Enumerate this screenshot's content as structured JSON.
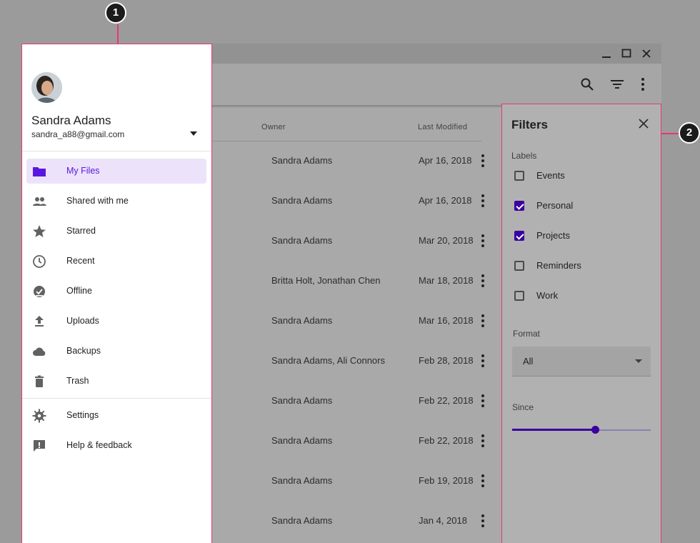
{
  "window": {
    "controls": [
      "minimize-icon",
      "maximize-icon",
      "close-icon"
    ],
    "appbar_icons": [
      "search-icon",
      "filter-list-icon",
      "more-vert-icon"
    ]
  },
  "table": {
    "headers": {
      "owner": "Owner",
      "modified": "Last Modified"
    },
    "rows": [
      {
        "owner": "Sandra Adams",
        "date": "Apr 16, 2018"
      },
      {
        "owner": "Sandra Adams",
        "date": "Apr 16, 2018"
      },
      {
        "owner": "Sandra Adams",
        "date": "Mar 20, 2018"
      },
      {
        "owner": "Britta Holt, Jonathan Chen",
        "date": "Mar 18, 2018"
      },
      {
        "owner": "Sandra Adams",
        "date": "Mar 16, 2018"
      },
      {
        "owner": "Sandra Adams, Ali Connors",
        "date": "Feb 28, 2018"
      },
      {
        "owner": "Sandra Adams",
        "date": "Feb 22, 2018"
      },
      {
        "owner": "Sandra Adams",
        "date": "Feb 22, 2018"
      },
      {
        "owner": "Sandra Adams",
        "date": "Feb 19, 2018"
      },
      {
        "owner": "Sandra Adams",
        "date": "Jan 4, 2018"
      }
    ]
  },
  "drawer": {
    "user": {
      "name": "Sandra Adams",
      "email": "sandra_a88@gmail.com"
    },
    "nav": [
      {
        "label": "My Files",
        "icon": "folder-icon",
        "active": true
      },
      {
        "label": "Shared with me",
        "icon": "people-icon",
        "active": false
      },
      {
        "label": "Starred",
        "icon": "star-icon",
        "active": false
      },
      {
        "label": "Recent",
        "icon": "clock-icon",
        "active": false
      },
      {
        "label": "Offline",
        "icon": "offline-check-icon",
        "active": false
      },
      {
        "label": "Uploads",
        "icon": "upload-icon",
        "active": false
      },
      {
        "label": "Backups",
        "icon": "cloud-icon",
        "active": false
      },
      {
        "label": "Trash",
        "icon": "trash-icon",
        "active": false
      }
    ],
    "secondary": [
      {
        "label": "Settings",
        "icon": "gear-icon"
      },
      {
        "label": "Help & feedback",
        "icon": "feedback-icon"
      }
    ]
  },
  "filters": {
    "title": "Filters",
    "labels_heading": "Labels",
    "labels": [
      {
        "label": "Events",
        "checked": false
      },
      {
        "label": "Personal",
        "checked": true
      },
      {
        "label": "Projects",
        "checked": true
      },
      {
        "label": "Reminders",
        "checked": false
      },
      {
        "label": "Work",
        "checked": false
      }
    ],
    "format_heading": "Format",
    "format_value": "All",
    "since_heading": "Since",
    "since_fraction": 0.6
  },
  "callouts": [
    "1",
    "2"
  ],
  "colors": {
    "accent": "#5b17e0",
    "active_bg": "#ece3fb",
    "annotation": "#e8386f"
  }
}
